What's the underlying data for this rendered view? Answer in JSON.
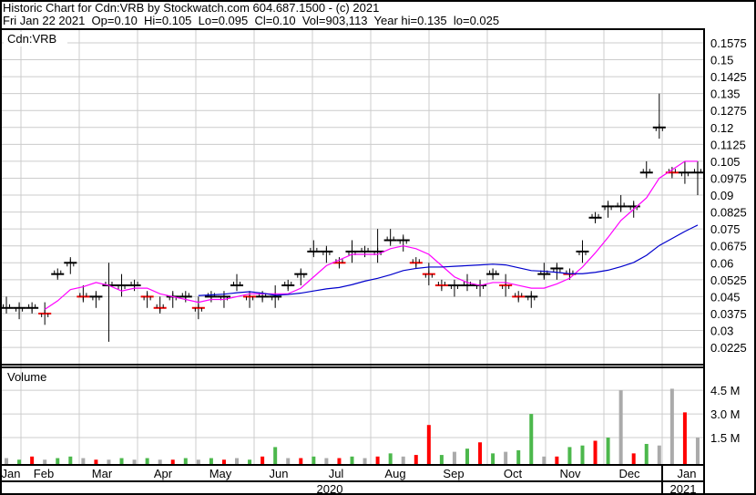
{
  "header": {
    "title": "Historic Chart for Cdn:VRB by Stockwatch.com 604.687.1500 - (c) 2021",
    "quote": "Fri Jan 22 2021  Op=0.10  Hi=0.105  Lo=0.095  Cl=0.10  Vol=903,113  Year hi=0.135  lo=0.025"
  },
  "chart_data": [
    {
      "type": "line",
      "title": "Cdn:VRB",
      "series_kind": "price bars (weekly approx) with moving averages",
      "ylim": [
        0.015,
        0.165
      ],
      "yticks": [
        "0.1575",
        "0.15",
        "0.1425",
        "0.135",
        "0.1275",
        "0.12",
        "0.1125",
        "0.105",
        "0.0975",
        "0.09",
        "0.0825",
        "0.075",
        "0.0675",
        "0.06",
        "0.0525",
        "0.045",
        "0.0375",
        "0.03",
        "0.0225"
      ],
      "close": [
        0.04,
        0.04,
        0.04,
        0.0375,
        0.055,
        0.06,
        0.045,
        0.045,
        0.05,
        0.05,
        0.05,
        0.045,
        0.04,
        0.045,
        0.045,
        0.04,
        0.045,
        0.045,
        0.05,
        0.045,
        0.045,
        0.045,
        0.05,
        0.055,
        0.065,
        0.065,
        0.06,
        0.065,
        0.065,
        0.065,
        0.07,
        0.07,
        0.06,
        0.055,
        0.05,
        0.05,
        0.05,
        0.05,
        0.055,
        0.05,
        0.045,
        0.045,
        0.055,
        0.0575,
        0.055,
        0.065,
        0.08,
        0.085,
        0.085,
        0.085,
        0.1,
        0.12,
        0.1,
        0.1,
        0.1
      ],
      "range_default": 0.005,
      "high_overrides": {
        "8": 0.06,
        "29": 0.075,
        "50": 0.105,
        "51": 0.135,
        "53": 0.105,
        "54": 0.105
      },
      "low_overrides": {
        "8": 0.025,
        "54": 0.09
      },
      "ma_short": {
        "period": 4,
        "color": "#ff00ff"
      },
      "ma_long": {
        "period": 16,
        "color": "#0000cc"
      }
    },
    {
      "type": "bar",
      "title": "Volume",
      "yticks": [
        "4.5 M",
        "3.0 M",
        "1.5 M"
      ],
      "ylim": [
        0,
        5.5
      ],
      "values": [
        0.2,
        0.1,
        0.3,
        0.1,
        0.2,
        0.3,
        0.2,
        0.1,
        0.1,
        0.2,
        0.1,
        0.2,
        0.1,
        0.1,
        0.2,
        0.1,
        0.2,
        0.1,
        0.2,
        0.1,
        0.3,
        0.9,
        0.2,
        0.2,
        0.3,
        0.2,
        0.2,
        0.3,
        0.2,
        0.3,
        0.5,
        0.3,
        0.4,
        2.3,
        0.4,
        0.6,
        0.8,
        1.2,
        0.5,
        0.6,
        0.7,
        3.0,
        0.3,
        0.3,
        0.9,
        1.0,
        1.3,
        1.5,
        4.5,
        0.5,
        1.1,
        1.0,
        4.6,
        3.1,
        1.5
      ],
      "colors": [
        "gray",
        "green",
        "red",
        "gray",
        "green",
        "green",
        "gray",
        "red",
        "gray",
        "green",
        "gray",
        "green",
        "gray",
        "red",
        "green",
        "gray",
        "green",
        "red",
        "gray",
        "green",
        "red",
        "green",
        "gray",
        "red",
        "green",
        "gray",
        "red",
        "green",
        "gray",
        "red",
        "green",
        "gray",
        "red",
        "red",
        "green",
        "gray",
        "green",
        "red",
        "green",
        "gray",
        "green",
        "green",
        "gray",
        "red",
        "green",
        "green",
        "red",
        "green",
        "gray",
        "red",
        "green",
        "gray",
        "gray",
        "red",
        "gray"
      ]
    },
    {
      "xticks": [
        "Jan",
        "Feb",
        "Mar",
        "Apr",
        "May",
        "Jun",
        "Jul",
        "Aug",
        "Sep",
        "Oct",
        "Nov",
        "Dec",
        "Jan"
      ],
      "years": [
        "2020",
        "2021"
      ]
    }
  ]
}
